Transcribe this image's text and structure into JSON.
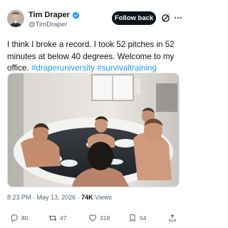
{
  "author": {
    "name": "Tim Draper",
    "handle": "@TimDraper"
  },
  "header": {
    "follow_label": "Follow back"
  },
  "tweet": {
    "text_plain": "I think I broke a record. I took 52 pitches in 52 minutes at below 40 degrees. Welcome to my office.",
    "hashtags": [
      "#draperuniversity",
      "#survivaltraining"
    ]
  },
  "meta": {
    "time": "8:23 PM",
    "separator": "·",
    "date": "May 13, 2026",
    "views_count": "74K",
    "views_label": "Views"
  },
  "actions": {
    "replies": "80",
    "reposts": "47",
    "likes": "318",
    "bookmarks": "54"
  },
  "colors": {
    "accent": "#1d9bf0",
    "verified": "#1d9bf0",
    "follow_bg": "#0f1419"
  },
  "icons": [
    "verified-badge-icon",
    "grok-icon",
    "more-icon",
    "reply-icon",
    "repost-icon",
    "like-icon",
    "bookmark-icon",
    "share-icon"
  ]
}
